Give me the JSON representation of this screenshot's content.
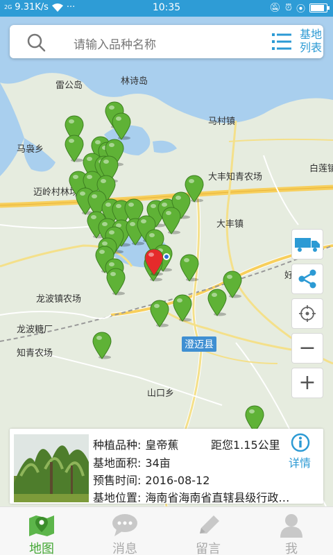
{
  "status_bar": {
    "signal": "2G",
    "network_speed": "9.31K/s",
    "more": "···",
    "time": "10:35",
    "battery_level": 0.9
  },
  "search": {
    "placeholder": "请输入品种名称",
    "list_label": "基地列表"
  },
  "map": {
    "labels": [
      {
        "text": "雷公岛"
      },
      {
        "text": "林诗岛"
      },
      {
        "text": "马村镇"
      },
      {
        "text": "马袅乡"
      },
      {
        "text": "大丰知青农场"
      },
      {
        "text": "白莲镇"
      },
      {
        "text": "迈岭村林场"
      },
      {
        "text": "大丰镇"
      },
      {
        "text": "龙波镇农场"
      },
      {
        "text": "龙波糖厂"
      },
      {
        "text": "知青农场"
      },
      {
        "text": "山口乡"
      },
      {
        "text": "好…农场"
      }
    ],
    "county_label": "澄迈县",
    "water_color": "#a9cfee",
    "land_color": "#e6ecdf",
    "road_color": "#f7cf5c",
    "marker_color": "#5fb236",
    "selected_marker_color": "#e52b2b"
  },
  "controls": {
    "zoom_in": "+",
    "zoom_out": "−"
  },
  "card": {
    "variety_label": "种植品种:",
    "variety_value": "皇帝蕉",
    "distance": "距您1.15公里",
    "area_label": "基地面积:",
    "area_value": "34亩",
    "presale_label": "预售时间:",
    "presale_value": "2016-08-12",
    "location_label": "基地位置:",
    "location_value": "海南省海南省直辖县级行政…",
    "detail_label": "详情"
  },
  "nav": {
    "items": [
      {
        "label": "地图",
        "active": true
      },
      {
        "label": "消息",
        "active": false
      },
      {
        "label": "留言",
        "active": false
      },
      {
        "label": "我",
        "active": false
      }
    ]
  }
}
